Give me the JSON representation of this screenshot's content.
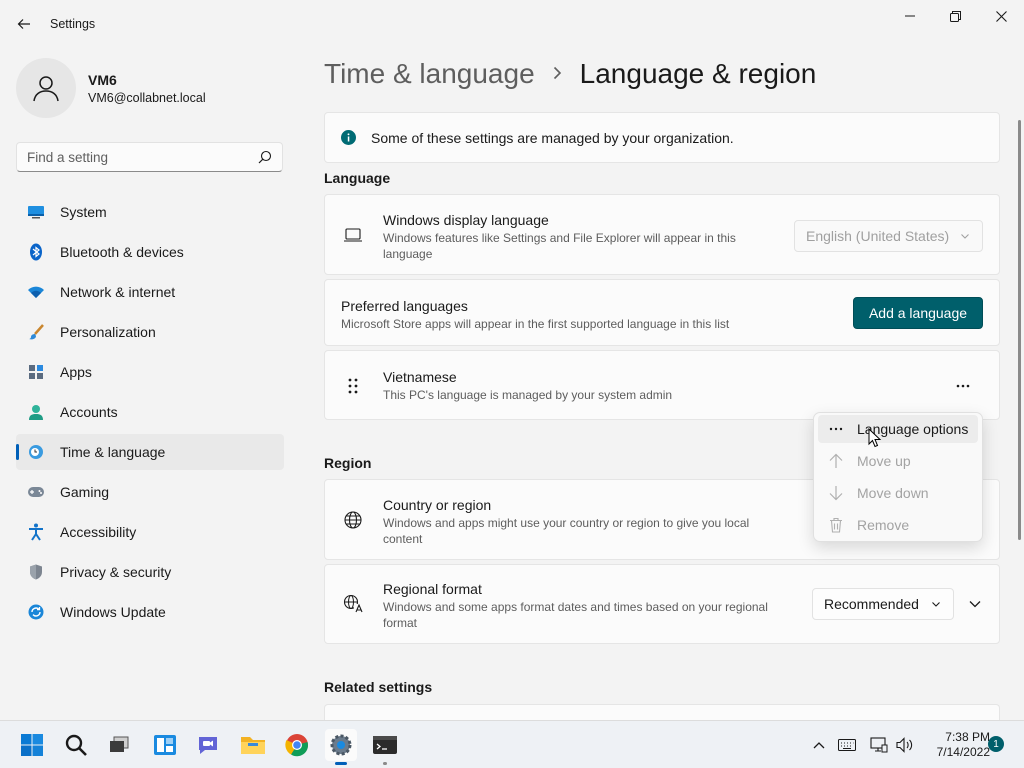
{
  "window": {
    "title": "Settings"
  },
  "user": {
    "name": "VM6",
    "email": "VM6@collabnet.local"
  },
  "search": {
    "placeholder": "Find a setting"
  },
  "sidebar": {
    "items": [
      {
        "label": "System",
        "icon": "system-icon"
      },
      {
        "label": "Bluetooth & devices",
        "icon": "bluetooth-icon"
      },
      {
        "label": "Network & internet",
        "icon": "wifi-icon"
      },
      {
        "label": "Personalization",
        "icon": "brush-icon"
      },
      {
        "label": "Apps",
        "icon": "apps-icon"
      },
      {
        "label": "Accounts",
        "icon": "person-icon"
      },
      {
        "label": "Time & language",
        "icon": "clock-globe-icon",
        "active": true
      },
      {
        "label": "Gaming",
        "icon": "gamepad-icon"
      },
      {
        "label": "Accessibility",
        "icon": "accessibility-icon"
      },
      {
        "label": "Privacy & security",
        "icon": "shield-icon"
      },
      {
        "label": "Windows Update",
        "icon": "update-icon"
      }
    ]
  },
  "breadcrumb": {
    "parent": "Time & language",
    "separator": ">",
    "current": "Language & region"
  },
  "banner": {
    "text": "Some of these settings are managed by your organization."
  },
  "language": {
    "section_title": "Language",
    "display_language": {
      "title": "Windows display language",
      "desc": "Windows features like Settings and File Explorer will appear in this language",
      "value": "English (United States)"
    },
    "preferred": {
      "title": "Preferred languages",
      "desc": "Microsoft Store apps will appear in the first supported language in this list",
      "button": "Add a language"
    },
    "vietnamese": {
      "title": "Vietnamese",
      "desc": "This PC's language is managed by your system admin"
    }
  },
  "context_menu": {
    "items": [
      {
        "label": "Language options",
        "enabled": true
      },
      {
        "label": "Move up",
        "enabled": false
      },
      {
        "label": "Move down",
        "enabled": false
      },
      {
        "label": "Remove",
        "enabled": false
      }
    ]
  },
  "region": {
    "section_title": "Region",
    "country": {
      "title": "Country or region",
      "desc": "Windows and apps might use your country or region to give you local content"
    },
    "format": {
      "title": "Regional format",
      "desc": "Windows and some apps format dates and times based on your regional format",
      "value": "Recommended"
    }
  },
  "related": {
    "section_title": "Related settings"
  },
  "taskbar": {
    "time": "7:38 PM",
    "date": "7/14/2022",
    "notification_count": "1"
  },
  "colors": {
    "accent": "#005fb8",
    "button": "#005f6b"
  }
}
